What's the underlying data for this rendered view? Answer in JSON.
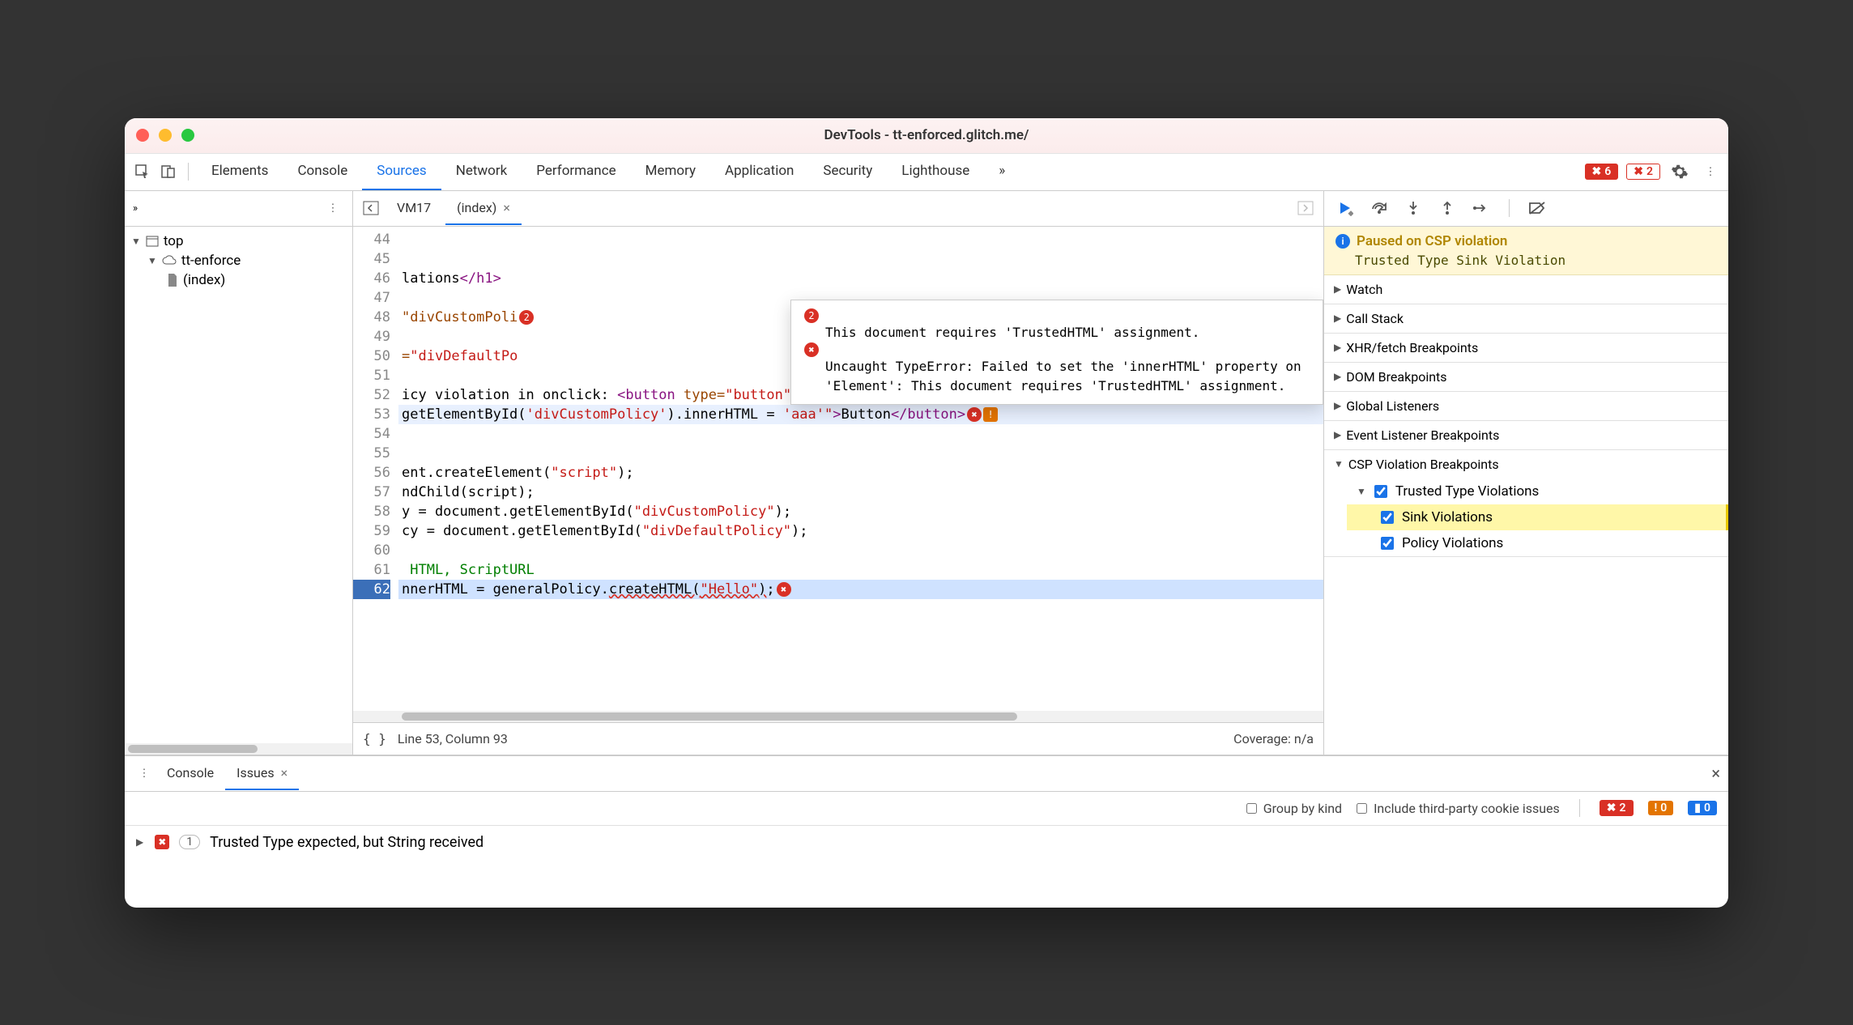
{
  "window": {
    "title": "DevTools - tt-enforced.glitch.me/"
  },
  "panels": {
    "items": [
      "Elements",
      "Console",
      "Sources",
      "Network",
      "Performance",
      "Memory",
      "Application",
      "Security",
      "Lighthouse"
    ],
    "active": "Sources"
  },
  "header_badges": {
    "errors": "6",
    "issues": "2"
  },
  "nav_tree": {
    "root": "top",
    "site": "tt-enforce",
    "file": "(index)"
  },
  "file_tabs": {
    "items": [
      "VM17",
      "(index)"
    ],
    "active": "(index)"
  },
  "editor": {
    "first_line": 44,
    "exec_line": 62,
    "highlight_line": 53,
    "lines": {
      "46": "lations</h1>",
      "48": "\"divCustomPoli",
      "50": "=\"divDefaultPo",
      "52": "icy violation in onclick: <button type=\"button\"",
      "53": "getElementById('divCustomPolicy').innerHTML = 'aaa'\">Button</button>",
      "56": "ent.createElement(\"script\");",
      "57": "ndChild(script);",
      "58": "y = document.getElementById(\"divCustomPolicy\");",
      "59": "cy = document.getElementById(\"divDefaultPolicy\");",
      "61": " HTML, ScriptURL",
      "62": "nnerHTML = generalPolicy.createHTML(\"Hello\");"
    }
  },
  "tooltip": {
    "count": "2",
    "msg1": "This document requires 'TrustedHTML' assignment.",
    "msg2": "Uncaught TypeError: Failed to set the 'innerHTML' property on 'Element': This document requires 'TrustedHTML' assignment."
  },
  "statusbar": {
    "pos": "Line 53, Column 93",
    "coverage": "Coverage: n/a"
  },
  "paused": {
    "title": "Paused on CSP violation",
    "detail": "Trusted Type Sink Violation"
  },
  "debug_sections": {
    "watch": "Watch",
    "callstack": "Call Stack",
    "xhr": "XHR/fetch Breakpoints",
    "dom": "DOM Breakpoints",
    "global": "Global Listeners",
    "event": "Event Listener Breakpoints",
    "csp": "CSP Violation Breakpoints",
    "tt": "Trusted Type Violations",
    "sink": "Sink Violations",
    "policy": "Policy Violations"
  },
  "drawer": {
    "tabs": [
      "Console",
      "Issues"
    ],
    "active": "Issues",
    "group_by_kind": "Group by kind",
    "third_party": "Include third-party cookie issues",
    "counts": {
      "err": "2",
      "warn": "0",
      "info": "0"
    },
    "issues": [
      {
        "count": "1",
        "text": "Trusted Type expected, but String received"
      }
    ]
  }
}
